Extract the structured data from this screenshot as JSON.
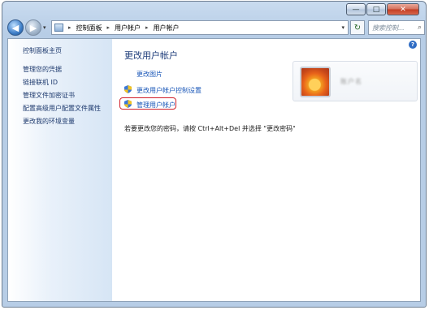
{
  "window": {
    "minimize_label": "—",
    "maximize_label": "□",
    "close_label": "✕"
  },
  "nav": {
    "back_glyph": "◀",
    "forward_glyph": "▶",
    "dropdown_glyph": "▾"
  },
  "address": {
    "breadcrumb": [
      "控制面板",
      "用户帐户",
      "用户帐户"
    ],
    "separator": "▸",
    "dropdown_glyph": "▾",
    "refresh_glyph": "↻"
  },
  "search": {
    "placeholder": "搜索控制...",
    "icon_glyph": "⌕"
  },
  "sidebar": {
    "items": [
      {
        "label": "控制面板主页"
      },
      {
        "label": "管理您的凭据"
      },
      {
        "label": "链接联机 ID"
      },
      {
        "label": "管理文件加密证书"
      },
      {
        "label": "配置高级用户配置文件属性"
      },
      {
        "label": "更改我的环境变量"
      }
    ]
  },
  "main": {
    "help_glyph": "?",
    "title": "更改用户帐户",
    "links": {
      "change_picture": "更改图片",
      "uac_settings": "更改用户帐户控制设置",
      "manage_accounts": "管理用户帐户"
    },
    "note": "若要更改您的密码，请按 Ctrl+Alt+Del 并选择 \"更改密码\"",
    "user": {
      "name": "账户名"
    }
  },
  "colors": {
    "link": "#1a57b8",
    "title": "#1e3c7a",
    "highlight_border": "#d0202a"
  }
}
